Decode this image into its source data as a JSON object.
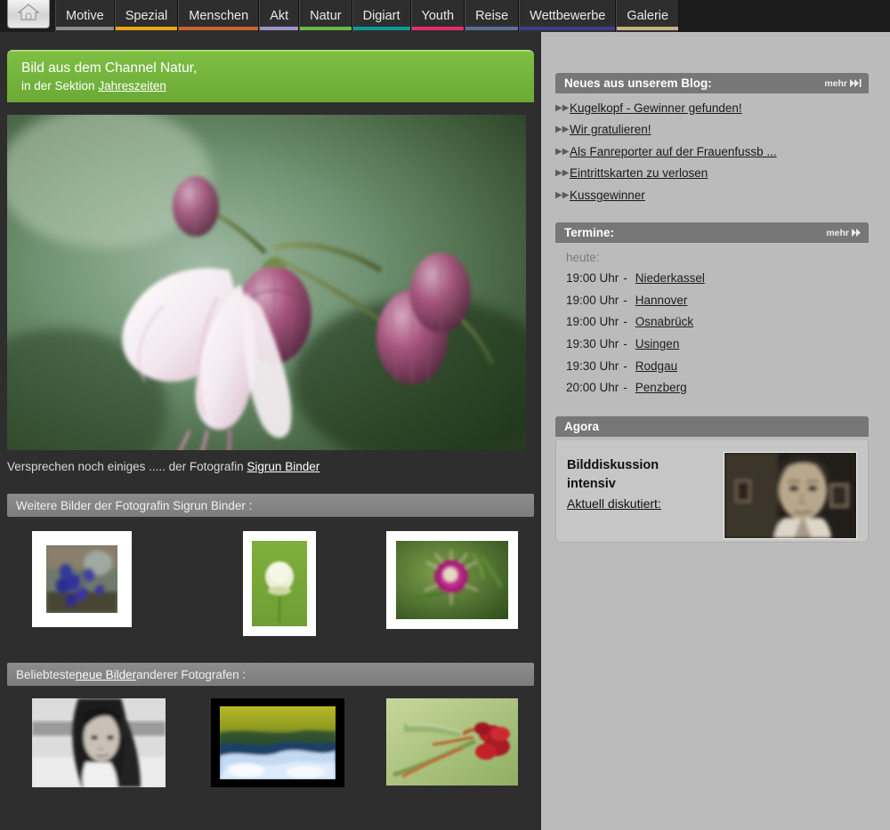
{
  "nav": {
    "home_icon": "home-icon",
    "items": [
      {
        "label": "Motive",
        "underline": "#8c8c8c"
      },
      {
        "label": "Spezial",
        "underline": "#e8a713"
      },
      {
        "label": "Menschen",
        "underline": "#c9642a"
      },
      {
        "label": "Akt",
        "underline": "#a093c9"
      },
      {
        "label": "Natur",
        "underline": "#6bb845"
      },
      {
        "label": "Digiart",
        "underline": "#0c9a96"
      },
      {
        "label": "Youth",
        "underline": "#e62d69"
      },
      {
        "label": "Reise",
        "underline": "#5b6e96"
      },
      {
        "label": "Wettbewerbe",
        "underline": "#3a3f86"
      },
      {
        "label": "Galerie",
        "underline": "#c9b183"
      }
    ]
  },
  "channel": {
    "line1": "Bild aus dem Channel Natur,",
    "line2_prefix": "in  der Sektion ",
    "section_link": "Jahreszeiten",
    "accent": "#74b43c"
  },
  "photo": {
    "caption_text": "Versprechen noch einiges ..... der Fotografin ",
    "photographer_link": "Sigrun Binder"
  },
  "sections": {
    "more_by_photographer": "Weitere Bilder der Fotografin Sigrun Binder :",
    "popular_prefix": "Beliebteste ",
    "popular_link": "neue Bilder",
    "popular_suffix": " anderer Fotografen :"
  },
  "thumbs_photographer": [
    {
      "name": "thumbnail-bluebells"
    },
    {
      "name": "thumbnail-white-bud"
    },
    {
      "name": "thumbnail-thistle"
    }
  ],
  "thumbs_popular": [
    {
      "name": "thumbnail-portrait-bw"
    },
    {
      "name": "thumbnail-waterfall"
    },
    {
      "name": "thumbnail-red-flower"
    }
  ],
  "blog": {
    "title": "Neues aus unserem Blog:",
    "more_label": "mehr",
    "more_icon": "double-arrow-end-icon",
    "items": [
      "Kugelkopf - Gewinner gefunden!",
      "Wir gratulieren!",
      "Als Fanreporter auf der Frauenfussb ...",
      "Eintrittskarten zu verlosen",
      "Kussgewinner"
    ]
  },
  "termine": {
    "title": "Termine:",
    "more_label": "mehr",
    "more_icon": "double-arrow-icon",
    "today_label": "heute:",
    "entries": [
      {
        "time": "19:00 Uhr",
        "sep": "-",
        "place": "Niederkassel"
      },
      {
        "time": "19:00 Uhr",
        "sep": "-",
        "place": "Hannover"
      },
      {
        "time": "19:00 Uhr",
        "sep": "-",
        "place": "Osnabrück"
      },
      {
        "time": "19:30 Uhr",
        "sep": "-",
        "place": "Usingen"
      },
      {
        "time": "19:30 Uhr",
        "sep": "-",
        "place": "Rodgau"
      },
      {
        "time": "20:00 Uhr",
        "sep": "-",
        "place": "Penzberg"
      }
    ]
  },
  "agora": {
    "title": "Agora",
    "heading_line1": "Bilddiskussion",
    "heading_line2": "intensiv",
    "link": "Aktuell diskutiert:",
    "image_name": "agora-portrait-photo"
  }
}
